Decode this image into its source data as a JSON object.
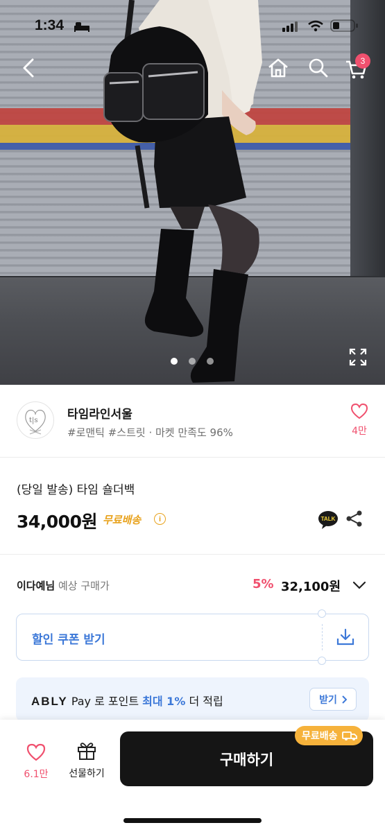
{
  "status_bar": {
    "time": "1:34"
  },
  "cart": {
    "badge_count": "3"
  },
  "carousel": {
    "pages": 3,
    "active": 0
  },
  "store": {
    "name": "타임라인서울",
    "tags": "#로맨틱 #스트릿 · 마켓 만족도 96%",
    "like_count": "4만"
  },
  "product": {
    "title": "(당일 발송) 타임 숄더백",
    "price": "34,000원",
    "shipping": "무료배송",
    "talk_label": "TALK"
  },
  "member_price": {
    "name": "이다예님",
    "label": "예상 구매가",
    "discount": "5%",
    "price": "32,100원"
  },
  "coupon": {
    "label": "할인 쿠폰 받기"
  },
  "ably_pay": {
    "brand": "ABLY",
    "pay": "Pay",
    "text_before": "로 포인트",
    "highlight": "최대 1%",
    "text_after": "더 적립",
    "button": "받기"
  },
  "bottom_bar": {
    "like_count": "6.1만",
    "gift_label": "선물하기",
    "buy_label": "구매하기",
    "ship_badge": "무료배송"
  },
  "colors": {
    "accent_pink": "#f0506e",
    "accent_blue": "#3c78d8",
    "accent_orange": "#f6b23b"
  }
}
